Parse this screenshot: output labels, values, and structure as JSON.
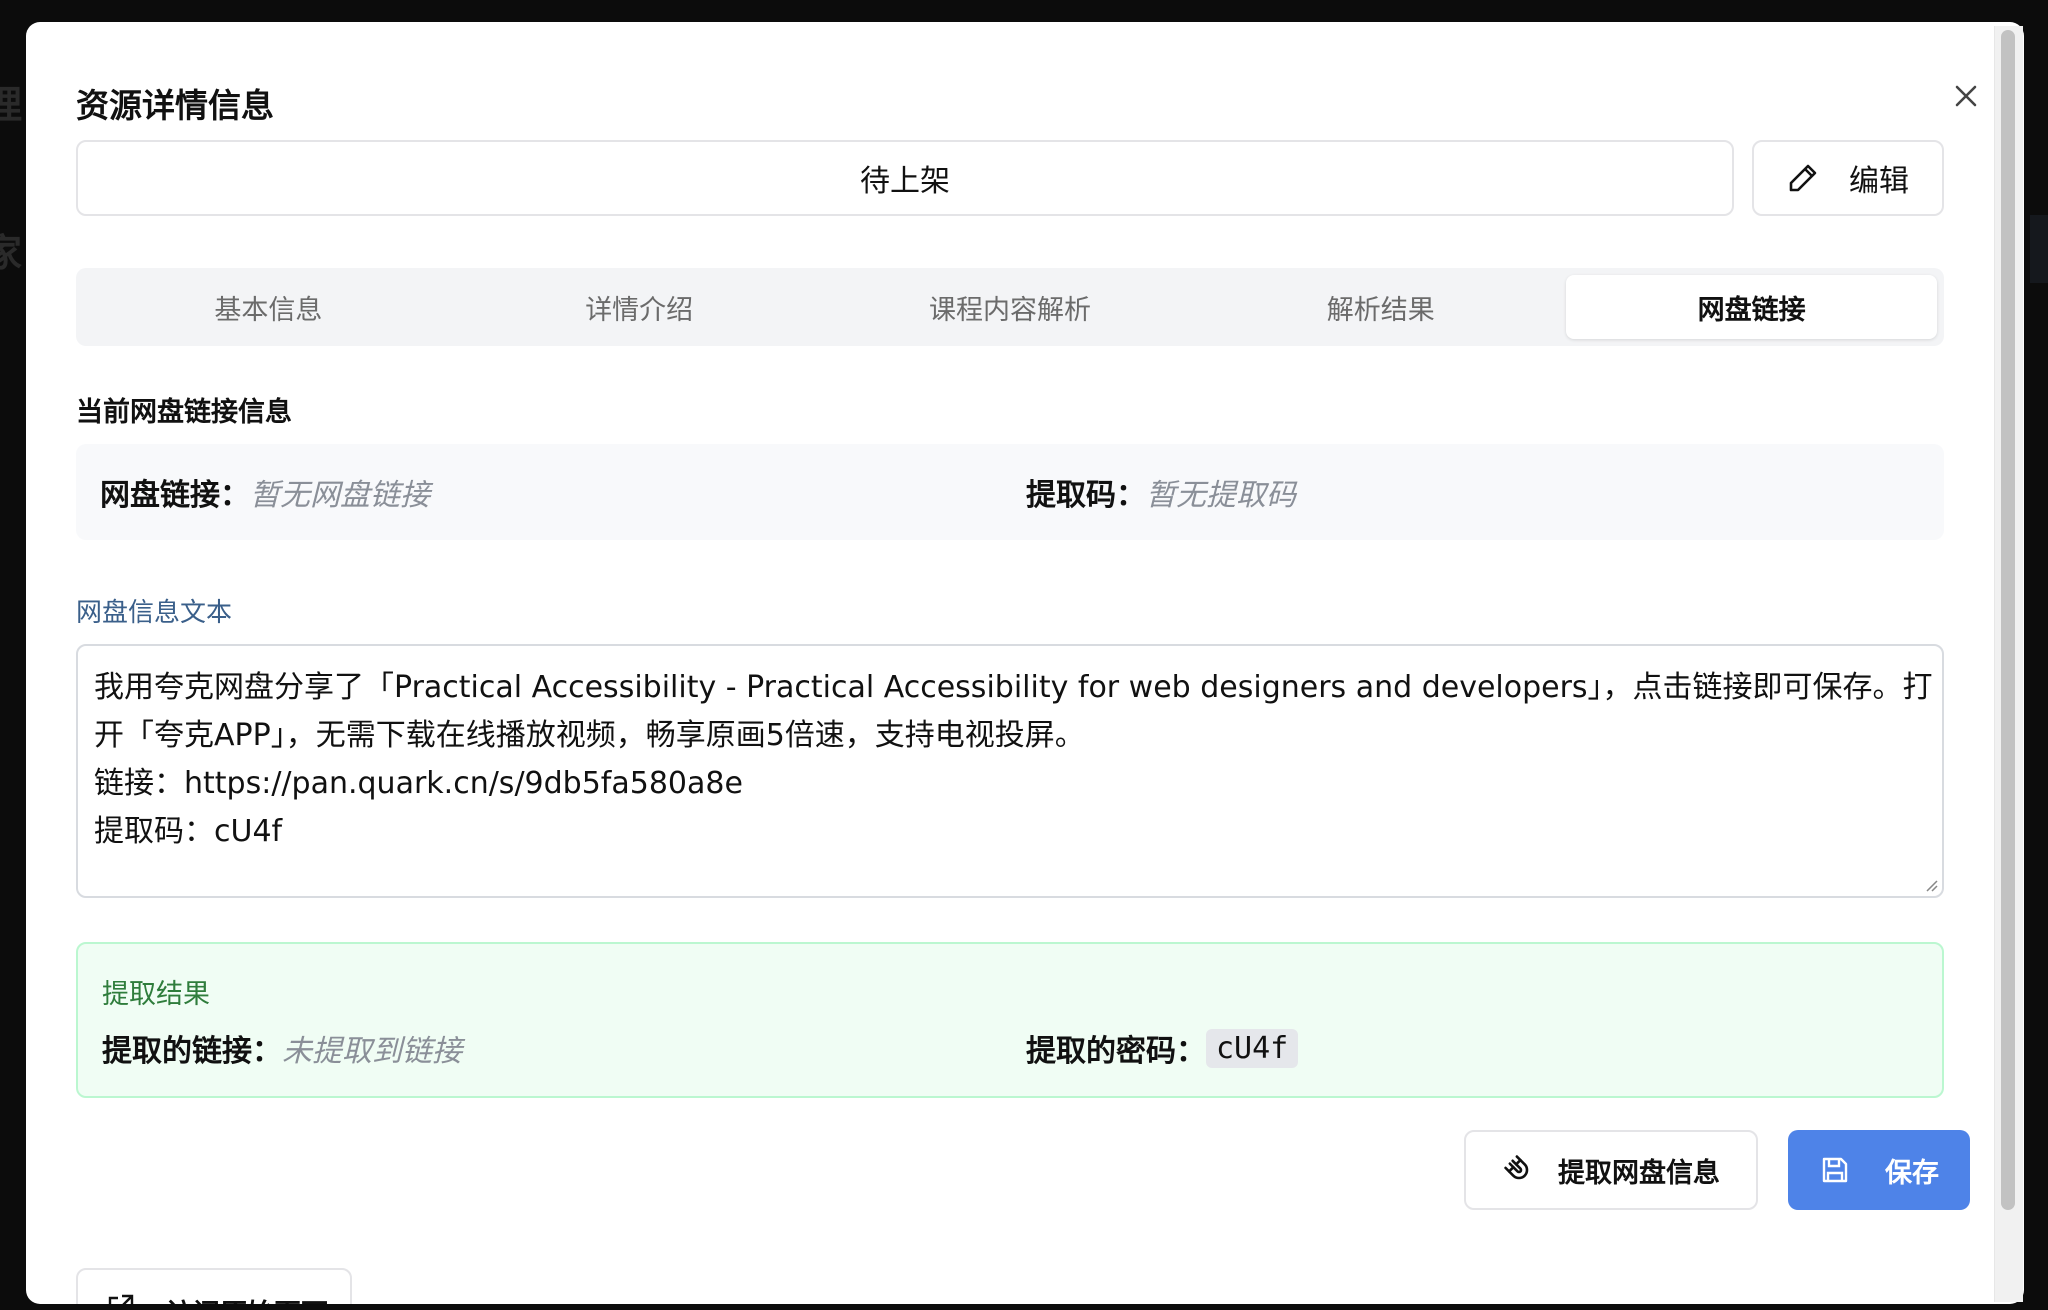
{
  "background": {
    "fragment_top": "理",
    "fragment_mid": "家"
  },
  "modal": {
    "title": "资源详情信息",
    "close_icon": "close-icon"
  },
  "status": {
    "value": "待上架",
    "edit_label": "编辑",
    "edit_icon": "pencil-icon"
  },
  "tabs": [
    {
      "label": "基本信息",
      "active": false
    },
    {
      "label": "详情介绍",
      "active": false
    },
    {
      "label": "课程内容解析",
      "active": false
    },
    {
      "label": "解析结果",
      "active": false
    },
    {
      "label": "网盘链接",
      "active": true
    }
  ],
  "current_link": {
    "section_label": "当前网盘链接信息",
    "link_key": "网盘链接：",
    "link_value": "暂无网盘链接",
    "code_key": "提取码：",
    "code_value": "暂无提取码"
  },
  "text_input": {
    "label": "网盘信息文本",
    "lines": [
      "我用夸克网盘分享了「Practical Accessibility - Practical Accessibility for web designers and developers」，点击链接即可保存。打",
      "开「夸克APP」，无需下载在线播放视频，畅享原画5倍速，支持电视投屏。",
      "链接：https://pan.quark.cn/s/9db5fa580a8e",
      "提取码：cU4f"
    ]
  },
  "result": {
    "title": "提取结果",
    "link_key": "提取的链接：",
    "link_value": "未提取到链接",
    "code_key": "提取的密码：",
    "code_value": "cU4f"
  },
  "actions": {
    "extract_label": "提取网盘信息",
    "extract_icon": "magnet-icon",
    "save_label": "保存",
    "save_icon": "save-icon",
    "visit_label": "访问原始页面",
    "visit_icon": "external-link-icon"
  },
  "colors": {
    "primary": "#4e83e8",
    "success_bg": "#f0fdf4",
    "success_border": "#bbf7d0",
    "success_text": "#2f7d3c"
  }
}
